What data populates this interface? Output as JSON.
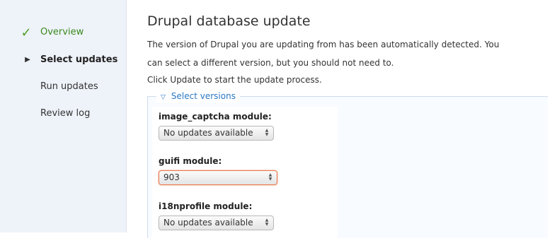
{
  "sidebar": {
    "tasks": [
      {
        "label": "Overview",
        "status": "done",
        "icon": "checkmark-icon"
      },
      {
        "label": "Select updates",
        "status": "active",
        "icon": "triangle-right-icon"
      },
      {
        "label": "Run updates",
        "status": "pending"
      },
      {
        "label": "Review log",
        "status": "pending"
      }
    ]
  },
  "main": {
    "title": "Drupal database update",
    "intro_line1": "The version of Drupal you are updating from has been automatically detected. You",
    "intro_line2": "can select a different version, but you should not need to.",
    "intro_line3": "Click Update to start the update process.",
    "fieldset": {
      "legend": "Select versions",
      "legend_icon": "triangle-down-icon",
      "modules": [
        {
          "label": "image_captcha module:",
          "value": "No updates available",
          "highlighted": false
        },
        {
          "label": "guifi module:",
          "value": "903",
          "highlighted": true
        },
        {
          "label": "i18nprofile module:",
          "value": "No updates available",
          "highlighted": false
        }
      ]
    }
  },
  "colors": {
    "sidebar_bg": "#eef2f9",
    "done": "#3a8a1e",
    "link": "#2a78c5",
    "focus_border": "#e8764a"
  }
}
